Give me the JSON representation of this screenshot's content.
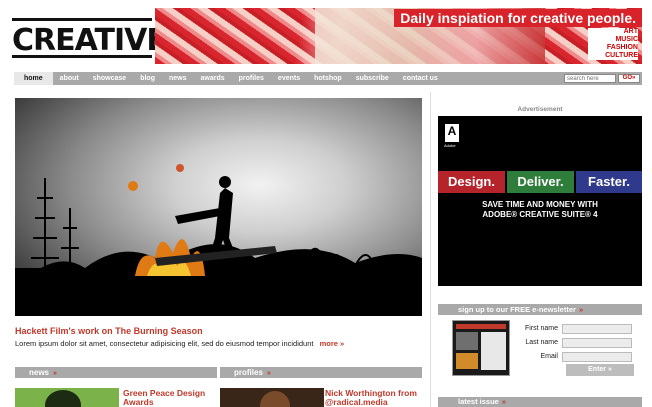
{
  "header": {
    "logo": "CREATIVE",
    "tagline": "Daily inspiation for creative people.",
    "categories": [
      "ART",
      "MUSIC",
      "FASHION",
      "CULTURE"
    ]
  },
  "nav": {
    "items": [
      "home",
      "about",
      "showcase",
      "blog",
      "news",
      "awards",
      "profiles",
      "events",
      "hotshop",
      "subscribe",
      "contact us"
    ],
    "active": "home",
    "search_placeholder": "search here",
    "search_button": "GO»"
  },
  "feature": {
    "title": "Hackett Film's work on The Burning Season",
    "excerpt": "Lorem ipsum dolor sit amet, consectetur adipisicing elit, sed do eiusmod tempor incididunt",
    "more": "more »"
  },
  "sections": {
    "news": {
      "label": "news",
      "item_title": "Green Peace Design Awards"
    },
    "profiles": {
      "label": "profiles",
      "item_title": "Nick Worthington from @radical.media"
    }
  },
  "advert": {
    "label": "Advertisement",
    "brand": "Adobe",
    "words": [
      "Design.",
      "Deliver.",
      "Faster."
    ],
    "tagline_line1": "SAVE TIME AND MONEY WITH",
    "tagline_line2": "ADOBE® CREATIVE SUITE® 4",
    "colors": {
      "design": "#b5232b",
      "deliver": "#2e7d3a",
      "faster": "#303a8c"
    }
  },
  "newsletter": {
    "heading": "sign up to our FREE e-newsletter",
    "first_name_label": "First name",
    "last_name_label": "Last name",
    "email_label": "Email",
    "submit_label": "Enter »"
  },
  "latest_issue": {
    "heading": "latest issue"
  },
  "colors": {
    "accent": "#c0392b",
    "bar": "#a9a9a9",
    "brand_red": "#d8232a"
  }
}
